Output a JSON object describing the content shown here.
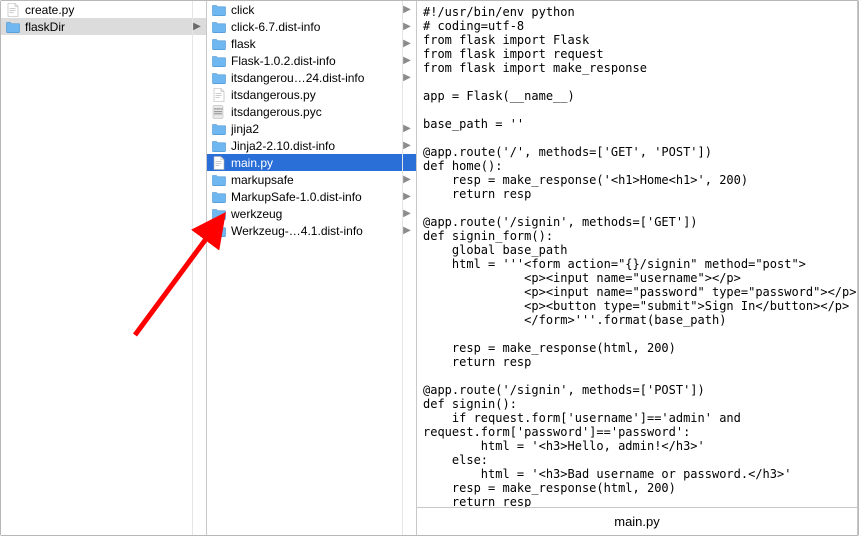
{
  "column1": {
    "items": [
      {
        "icon": "doc",
        "label": "create.py",
        "has_children": false,
        "selected": null
      },
      {
        "icon": "folder",
        "label": "flaskDir",
        "has_children": true,
        "selected": "grey"
      }
    ]
  },
  "column2": {
    "items": [
      {
        "icon": "folder",
        "label": "click",
        "has_children": true,
        "selected": null
      },
      {
        "icon": "folder",
        "label": "click-6.7.dist-info",
        "has_children": true,
        "selected": null
      },
      {
        "icon": "folder",
        "label": "flask",
        "has_children": true,
        "selected": null
      },
      {
        "icon": "folder",
        "label": "Flask-1.0.2.dist-info",
        "has_children": true,
        "selected": null
      },
      {
        "icon": "folder",
        "label": "itsdangerou…24.dist-info",
        "has_children": true,
        "selected": null
      },
      {
        "icon": "doc",
        "label": "itsdangerous.py",
        "has_children": false,
        "selected": null
      },
      {
        "icon": "pyc",
        "label": "itsdangerous.pyc",
        "has_children": false,
        "selected": null
      },
      {
        "icon": "folder",
        "label": "jinja2",
        "has_children": true,
        "selected": null
      },
      {
        "icon": "folder",
        "label": "Jinja2-2.10.dist-info",
        "has_children": true,
        "selected": null
      },
      {
        "icon": "doc",
        "label": "main.py",
        "has_children": false,
        "selected": "blue"
      },
      {
        "icon": "folder",
        "label": "markupsafe",
        "has_children": true,
        "selected": null
      },
      {
        "icon": "folder",
        "label": "MarkupSafe-1.0.dist-info",
        "has_children": true,
        "selected": null
      },
      {
        "icon": "folder",
        "label": "werkzeug",
        "has_children": true,
        "selected": null
      },
      {
        "icon": "folder",
        "label": "Werkzeug-…4.1.dist-info",
        "has_children": true,
        "selected": null
      }
    ]
  },
  "preview": {
    "filename": "main.py",
    "code": "#!/usr/bin/env python\n# coding=utf-8\nfrom flask import Flask\nfrom flask import request\nfrom flask import make_response\n\napp = Flask(__name__)\n\nbase_path = ''\n\n@app.route('/', methods=['GET', 'POST'])\ndef home():\n    resp = make_response('<h1>Home<h1>', 200)\n    return resp\n\n@app.route('/signin', methods=['GET'])\ndef signin_form():\n    global base_path\n    html = '''<form action=\"{}/signin\" method=\"post\">\n              <p><input name=\"username\"></p>\n              <p><input name=\"password\" type=\"password\"></p>\n              <p><button type=\"submit\">Sign In</button></p>\n              </form>'''.format(base_path)\n\n    resp = make_response(html, 200)\n    return resp\n\n@app.route('/signin', methods=['POST'])\ndef signin():\n    if request.form['username']=='admin' and\nrequest.form['password']=='password':\n        html = '<h3>Hello, admin!</h3>'\n    else:\n        html = '<h3>Bad username or password.</h3>'\n    resp = make_response(html, 200)\n    return resp\n\ndef handler(environ, start_response):"
  }
}
